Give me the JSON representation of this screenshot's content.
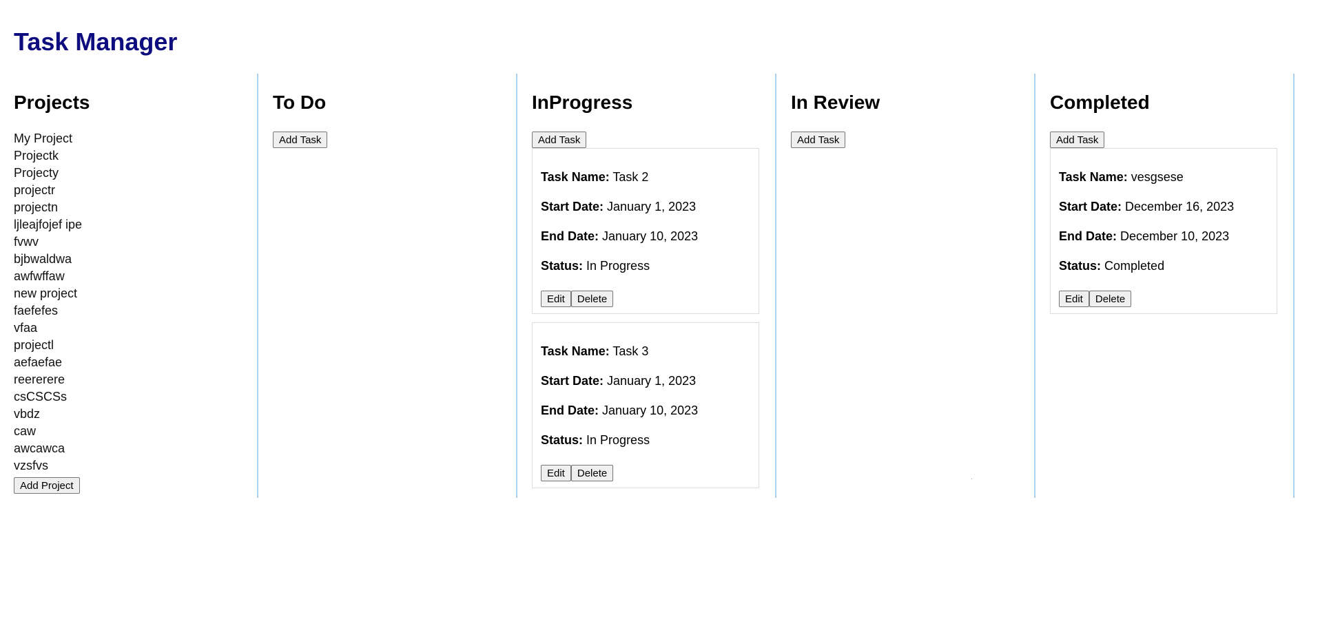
{
  "app": {
    "title": "Task Manager"
  },
  "projects": {
    "heading": "Projects",
    "items": [
      "My Project",
      "Projectk",
      "Projecty",
      "projectr",
      "projectn",
      "ljleajfojef ipe",
      "fvwv",
      "bjbwaldwa",
      "awfwffaw",
      "new project",
      "faefefes",
      "vfaa",
      "projectl",
      "aefaefae",
      "reererere",
      "csCSCSs",
      "vbdz",
      "caw",
      "awcawca",
      "vzsfvs"
    ],
    "add_label": "Add Project"
  },
  "columns": [
    {
      "title": "To Do",
      "add_label": "Add Task",
      "tasks": []
    },
    {
      "title": "InProgress",
      "add_label": "Add Task",
      "tasks": [
        {
          "name_label": "Task Name:",
          "name": "Task 2",
          "start_label": "Start Date:",
          "start": "January 1, 2023",
          "end_label": "End Date:",
          "end": "January 10, 2023",
          "status_label": "Status:",
          "status": "In Progress",
          "edit_label": "Edit",
          "delete_label": "Delete"
        },
        {
          "name_label": "Task Name:",
          "name": "Task 3",
          "start_label": "Start Date:",
          "start": "January 1, 2023",
          "end_label": "End Date:",
          "end": "January 10, 2023",
          "status_label": "Status:",
          "status": "In Progress",
          "edit_label": "Edit",
          "delete_label": "Delete"
        }
      ]
    },
    {
      "title": "In Review",
      "add_label": "Add Task",
      "tasks": []
    },
    {
      "title": "Completed",
      "add_label": "Add Task",
      "tasks": [
        {
          "name_label": "Task Name:",
          "name": "vesgsese",
          "start_label": "Start Date:",
          "start": "December 16, 2023",
          "end_label": "End Date:",
          "end": "December 10, 2023",
          "status_label": "Status:",
          "status": "Completed",
          "edit_label": "Edit",
          "delete_label": "Delete"
        }
      ]
    }
  ],
  "colors": {
    "title": "#0d0d80",
    "divider": "#a8d4ee",
    "card_border": "#dddddd"
  }
}
